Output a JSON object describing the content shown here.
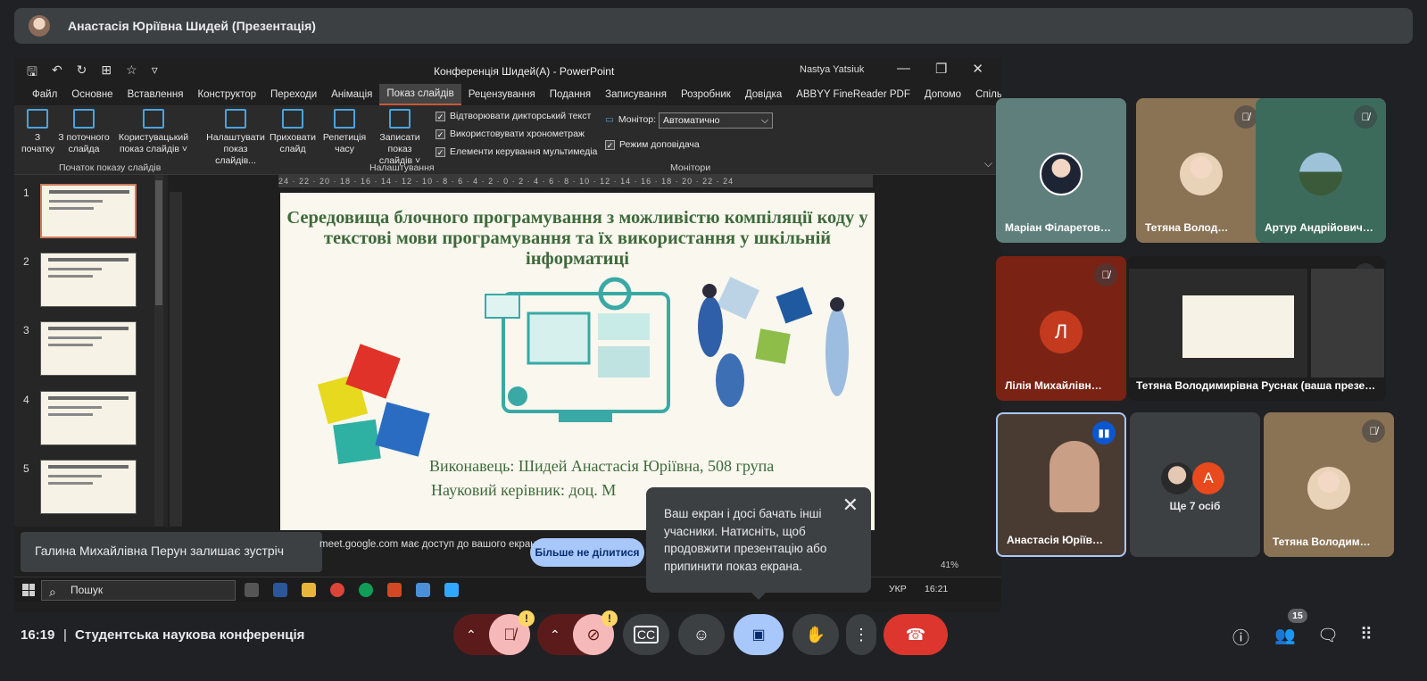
{
  "header": {
    "title": "Анастасія Юріївна Шидей (Презентація)"
  },
  "powerpoint": {
    "doc_title": "Конференція Шидей(А)  -  PowerPoint",
    "user_name": "Nastya Yatsiuk",
    "tabs": [
      "Файл",
      "Основне",
      "Вставлення",
      "Конструктор",
      "Переходи",
      "Анімація",
      "Показ слайдів",
      "Рецензування",
      "Подання",
      "Записування",
      "Розробник",
      "Довідка",
      "ABBYY FineReader PDF",
      "Допомо",
      "Спільний доступ"
    ],
    "active_tab": "Показ слайдів",
    "ribbon": {
      "from_start": "З\nпочатку",
      "from_current": "З поточного\nслайда",
      "custom_show": "Користувацький\nпоказ слайдів ˅",
      "group_start": "Початок показу слайдів",
      "setup": "Налаштувати\nпоказ слайдів...",
      "hide": "Приховати\nслайд",
      "rehearse": "Репетиція\nчасу",
      "record": "Записати показ\nслайдів ˅",
      "group_setup": "Налаштування",
      "check_narration": "Відтворювати дикторський текст",
      "check_timings": "Використовувати хронометраж",
      "check_media": "Елементи керування мультимедіа",
      "monitor_label": "Монітор:",
      "monitor_value": "Автоматично",
      "presenter_view": "Режим доповідача",
      "group_monitors": "Монітори"
    },
    "ruler_text": "24  ·  22  ·  20  ·  18  ·  16  ·  14  ·  12  ·  10  ·  8  ·  6  ·  4  ·  2  ·  0  ·  2  ·  4  ·  6  ·  8  ·  10  ·  12  ·  14  ·  16  ·  18  ·  20  ·  22  ·  24",
    "thumb_numbers": [
      "1",
      "2",
      "3",
      "4",
      "5"
    ],
    "slide": {
      "title": "Середовища блочного програмування з можливістю компіляції коду у текстові мови програмування та їх використання у шкільній інформатиці",
      "author": "Виконавець: Шидей Анастасія Юріївна, 508 група",
      "advisor": "Науковий керівник: доц. М"
    },
    "zoom": "41%",
    "taskbar": {
      "search": "Пошук",
      "lang": "УКР",
      "time": "16:21"
    }
  },
  "notifications": {
    "leave": "Галина Михайлівна Перун залишає зустріч",
    "share_access": "meet.google.com має доступ до вашого екрана.",
    "stop_sharing": "Більше не ділитися",
    "popup": "Ваш екран і досі бачать інші учасники. Натисніть, щоб продовжити презентацію або припинити показ екрана."
  },
  "participants": [
    {
      "name": "Маріан Філаретов…",
      "muted": false,
      "bg": "#5f7f7c",
      "initial": ""
    },
    {
      "name": "Тетяна Волод…",
      "muted": true,
      "bg": "#8a7255",
      "initial": ""
    },
    {
      "name": "Артур Андрійович…",
      "muted": true,
      "bg": "#3d6b5b",
      "initial": ""
    },
    {
      "name": "Лілія Михайлівн…",
      "muted": true,
      "bg": "#7a2314",
      "initial": "Л"
    },
    {
      "name": "Тетяна Володимирівна Руснак (ваша презен…",
      "muted": true,
      "bg": "#1d1d1d",
      "initial": ""
    },
    {
      "name": "Анастасія Юріїв…",
      "muted": false,
      "bg": "#4a3b32",
      "initial": ""
    },
    {
      "name": "Ще 7 осіб",
      "muted": false,
      "bg": "#3c4043",
      "initial": "A"
    },
    {
      "name": "Тетяна Володим…",
      "muted": true,
      "bg": "#8a7255",
      "initial": ""
    }
  ],
  "footer": {
    "time": "16:19",
    "separator": "|",
    "meeting": "Студентська наукова конференція",
    "people_count": "15"
  },
  "colors": {
    "end_call": "#dc362e",
    "present_active": "#a8c7fa",
    "warn": "#fdd663"
  }
}
